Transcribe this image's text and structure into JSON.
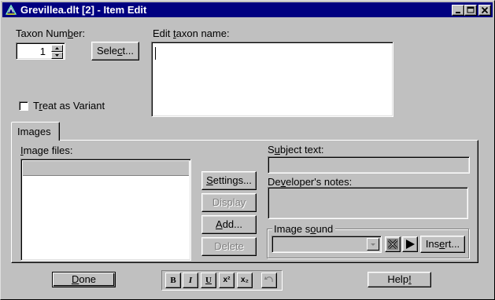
{
  "window": {
    "title": "Grevillea.dlt [2] - Item Edit"
  },
  "taxon": {
    "label_prefix": "Taxon Num",
    "label_u": "b",
    "label_suffix": "er:",
    "value": "1"
  },
  "select_button": {
    "prefix": "Sele",
    "u": "c",
    "suffix": "t..."
  },
  "edit_name": {
    "prefix": "Edit ",
    "u": "t",
    "suffix": "axon name:",
    "value": ""
  },
  "variant": {
    "prefix": "T",
    "u": "r",
    "suffix": "eat as Variant"
  },
  "images_tab": {
    "label": "Images"
  },
  "image_files": {
    "u": "I",
    "suffix": "mage files:"
  },
  "buttons": {
    "settings": {
      "prefix": "",
      "u": "S",
      "suffix": "ettings..."
    },
    "display": {
      "label": "Display"
    },
    "add": {
      "prefix": "",
      "u": "A",
      "suffix": "dd..."
    },
    "delete": {
      "label": "Delete"
    }
  },
  "subject_text": {
    "prefix": "S",
    "u": "u",
    "suffix": "bject text:"
  },
  "dev_notes": {
    "prefix": "De",
    "u": "v",
    "suffix": "eloper's notes:"
  },
  "image_sound": {
    "prefix": "Image s",
    "u": "o",
    "suffix": "und"
  },
  "insert_button": {
    "prefix": "Ins",
    "u": "e",
    "suffix": "rt..."
  },
  "done_button": {
    "prefix": "",
    "u": "D",
    "suffix": "one"
  },
  "help_button": {
    "prefix": "Help",
    "u": "!",
    "suffix": ""
  },
  "format_bar": {
    "bold": "B",
    "italic": "I",
    "underline": "U",
    "superscript": "x²",
    "subscript": "x₂"
  }
}
